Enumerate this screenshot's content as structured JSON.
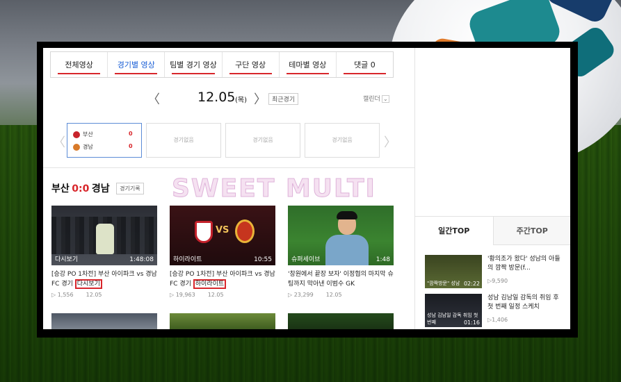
{
  "tabs": [
    {
      "label": "전체영상"
    },
    {
      "label": "경기별 영상"
    },
    {
      "label": "팀별 경기 영상"
    },
    {
      "label": "구단 영상"
    },
    {
      "label": "테마별 영상"
    },
    {
      "label": "댓글 0"
    }
  ],
  "datebar": {
    "prev": "〈",
    "date": "12.05",
    "dow": "(목)",
    "next": "〉",
    "recent": "최근경기",
    "calendar": "캘린더",
    "calendar_chevron": "⌄"
  },
  "games": {
    "prev": "〈",
    "next": "〉",
    "cards": [
      {
        "home": "부산",
        "home_score": "0",
        "away": "경남",
        "away_score": "0"
      },
      {
        "empty": "경기없음"
      },
      {
        "empty": "경기없음"
      },
      {
        "empty": "경기없음"
      }
    ]
  },
  "match": {
    "home": "부산",
    "score": "0:0",
    "away": "경남",
    "record_button": "경기기록"
  },
  "watermark": "SWEET MULTI STORY",
  "videos": [
    {
      "label": "다시보기",
      "duration": "1:48:08",
      "title_a": "[승강 PO 1차전] 부산 아이파크 vs 경남FC 경기 ",
      "title_hl": "다시보기",
      "views": "▷ 1,556",
      "date": "12.05"
    },
    {
      "label": "하이라이트",
      "duration": "10:55",
      "vs": "VS",
      "title_a": "[승강 PO 1차전] 부산 아이파크 vs 경남FC 경기 ",
      "title_hl": "하이라이트",
      "views": "▷ 19,963",
      "date": "12.05"
    },
    {
      "label": "슈퍼세이브",
      "duration": "1:48",
      "title_a": "'창원에서 끝장 보자' 이정협의 마지막 슈팅까지 막아낸 이범수 GK",
      "title_hl": "",
      "views": "▷ 23,299",
      "date": "12.05"
    }
  ],
  "sidebar": {
    "tab_daily": "일간TOP",
    "tab_weekly": "주간TOP",
    "items": [
      {
        "title": "'황의조가 왔다' 성남의 아들의 깜짝 방문(f...",
        "views": "▷9,590",
        "duration": "02:22",
        "caption": "\"깜짝방문\" 성남"
      },
      {
        "title": "성남 김남일 감독의 취임 후 첫 번째 일정 스케치",
        "views": "▷1,406",
        "duration": "01:16",
        "caption": "성남 김남일 감독 취임 첫 번째"
      }
    ]
  },
  "colors": {
    "accent_blue": "#1a5fd6",
    "accent_red": "#d8262b"
  }
}
